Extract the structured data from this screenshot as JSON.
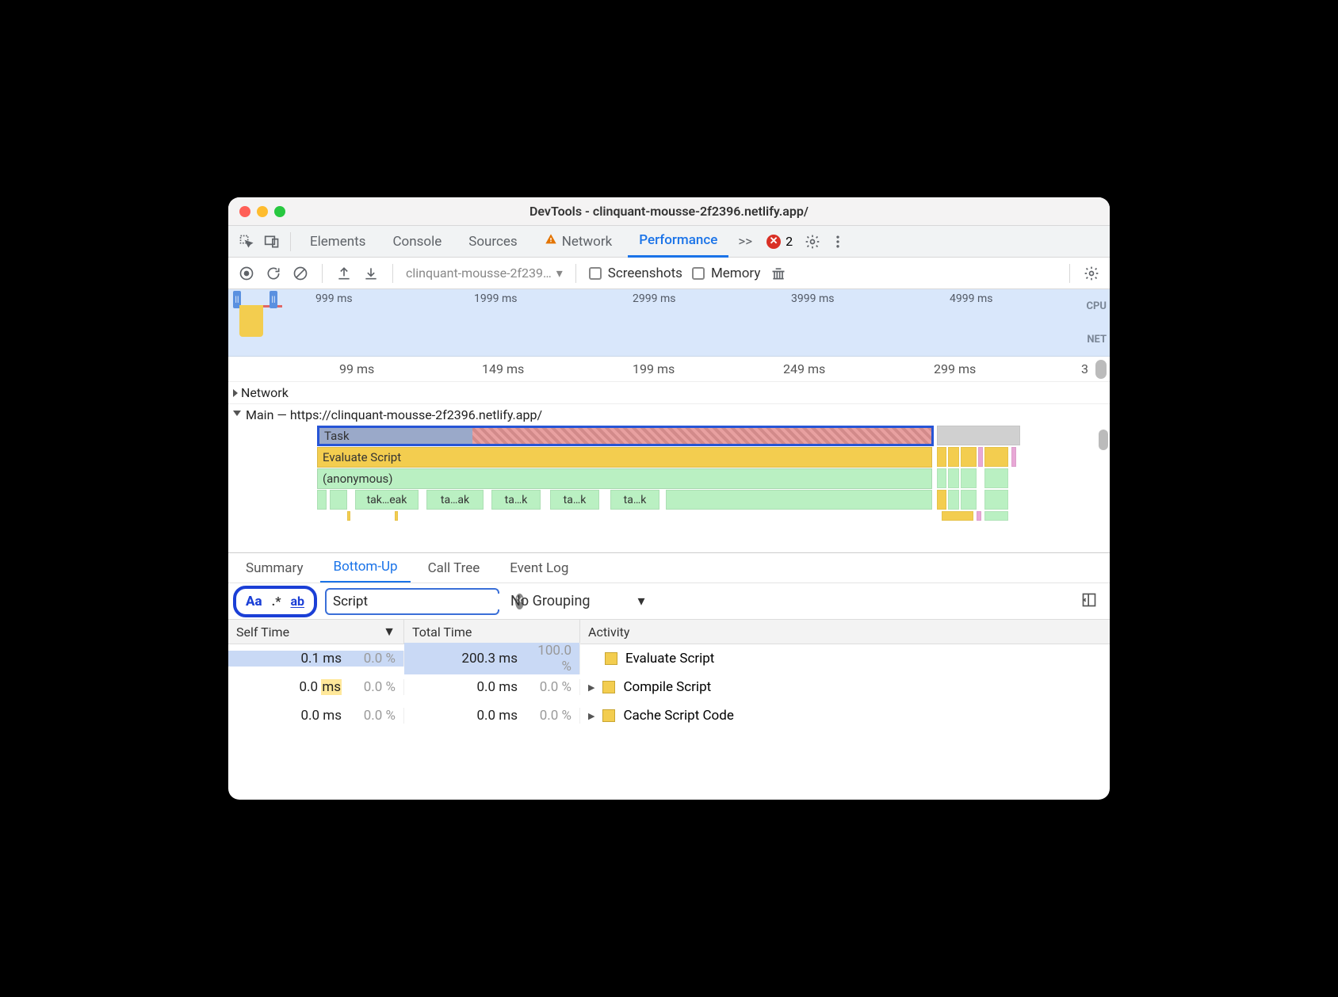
{
  "window": {
    "title": "DevTools - clinquant-mousse-2f2396.netlify.app/"
  },
  "tabs": {
    "items": [
      "Elements",
      "Console",
      "Sources",
      "Network",
      "Performance"
    ],
    "active": "Performance",
    "overflow_label": ">>",
    "error_count": "2"
  },
  "perf_toolbar": {
    "profile_name": "clinquant-mousse-2f239…",
    "screenshots_label": "Screenshots",
    "memory_label": "Memory"
  },
  "overview": {
    "ticks": [
      "999 ms",
      "1999 ms",
      "2999 ms",
      "3999 ms",
      "4999 ms"
    ],
    "side_labels": [
      "CPU",
      "NET"
    ]
  },
  "ruler": {
    "ticks": [
      "99 ms",
      "149 ms",
      "199 ms",
      "249 ms",
      "299 ms",
      "3"
    ]
  },
  "flame": {
    "network_label": "Network",
    "main_label": "Main — https://clinquant-mousse-2f2396.netlify.app/",
    "task_label": "Task",
    "evaluate_label": "Evaluate Script",
    "anon_label": "(anonymous)",
    "subs": [
      "tak…eak",
      "ta…ak",
      "ta…k",
      "ta…k",
      "ta…k"
    ]
  },
  "bottom_tabs": {
    "items": [
      "Summary",
      "Bottom-Up",
      "Call Tree",
      "Event Log"
    ],
    "active": "Bottom-Up"
  },
  "filter": {
    "match_case_label": "Aa",
    "regex_label": ".*",
    "whole_word_label": "ab",
    "query": "Script",
    "grouping_label": "No Grouping"
  },
  "table": {
    "headers": {
      "self": "Self Time",
      "total": "Total Time",
      "activity": "Activity"
    },
    "rows": [
      {
        "self_ms": "0.1 ms",
        "self_pct": "0.0 %",
        "total_ms": "200.3 ms",
        "total_pct": "100.0 %",
        "name": "Evaluate Script",
        "expandable": false,
        "selected": true
      },
      {
        "self_ms": "0.0 ms",
        "self_pct": "0.0 %",
        "total_ms": "0.0 ms",
        "total_pct": "0.0 %",
        "name": "Compile Script",
        "expandable": true,
        "selected": false,
        "hl_ms": true
      },
      {
        "self_ms": "0.0 ms",
        "self_pct": "0.0 %",
        "total_ms": "0.0 ms",
        "total_pct": "0.0 %",
        "name": "Cache Script Code",
        "expandable": true,
        "selected": false
      }
    ]
  }
}
